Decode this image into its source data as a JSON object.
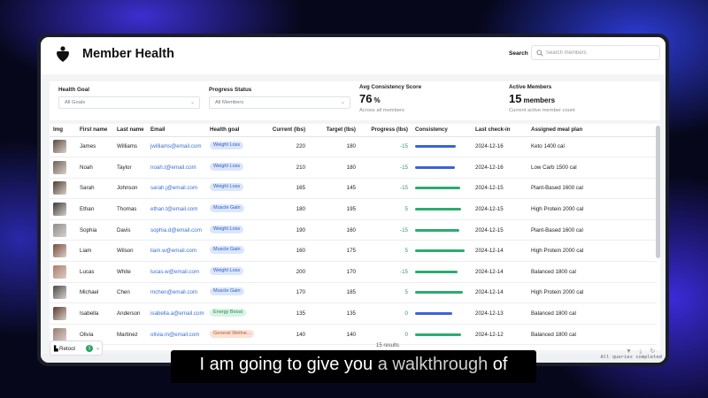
{
  "app": {
    "title": "Member Health",
    "search_label": "Search",
    "search_placeholder": "Search members"
  },
  "filters": {
    "health_goal_label": "Health Goal",
    "health_goal_value": "All Goals",
    "progress_status_label": "Progress Status",
    "progress_status_value": "All Members"
  },
  "stats": {
    "avg_consistency_label": "Avg Consistency Score",
    "avg_consistency_value": "76",
    "avg_consistency_unit": "%",
    "avg_consistency_sub": "Across all members",
    "active_members_label": "Active Members",
    "active_members_value": "15",
    "active_members_unit": "members",
    "active_members_sub": "Current active member count"
  },
  "table": {
    "columns": [
      "Img",
      "First name",
      "Last name",
      "Email",
      "Health goal",
      "Current (lbs)",
      "Target (lbs)",
      "Progress (lbs)",
      "Consistency",
      "Last check-in",
      "Assigned meal plan"
    ],
    "rows": [
      {
        "first": "James",
        "last": "Williams",
        "email": "jwilliams@email.com",
        "goal": "Weight Loss",
        "current": "220",
        "target": "180",
        "progress": "-15",
        "consistency": 0.72,
        "checkin": "2024-12-16",
        "plan": "Keto 1400 cal"
      },
      {
        "first": "Noah",
        "last": "Taylor",
        "email": "noah.t@email.com",
        "goal": "Weight Loss",
        "current": "210",
        "target": "180",
        "progress": "-15",
        "consistency": 0.7,
        "checkin": "2024-12-16",
        "plan": "Low Carb 1500 cal"
      },
      {
        "first": "Sarah",
        "last": "Johnson",
        "email": "sarah.j@email.com",
        "goal": "Weight Loss",
        "current": "165",
        "target": "145",
        "progress": "-15",
        "consistency": 0.8,
        "checkin": "2024-12-15",
        "plan": "Plant-Based 1600 cal"
      },
      {
        "first": "Ethan",
        "last": "Thomas",
        "email": "ethan.t@email.com",
        "goal": "Muscle Gain",
        "current": "180",
        "target": "195",
        "progress": "5",
        "consistency": 0.82,
        "checkin": "2024-12-15",
        "plan": "High Protein 2000 cal"
      },
      {
        "first": "Sophia",
        "last": "Davis",
        "email": "sophia.d@email.com",
        "goal": "Weight Loss",
        "current": "190",
        "target": "160",
        "progress": "-15",
        "consistency": 0.78,
        "checkin": "2024-12-15",
        "plan": "Plant-Based 1600 cal"
      },
      {
        "first": "Liam",
        "last": "Wilson",
        "email": "liam.w@email.com",
        "goal": "Muscle Gain",
        "current": "160",
        "target": "175",
        "progress": "5",
        "consistency": 0.88,
        "checkin": "2024-12-14",
        "plan": "High Protein 2000 cal"
      },
      {
        "first": "Lucas",
        "last": "White",
        "email": "lucas.w@email.com",
        "goal": "Weight Loss",
        "current": "200",
        "target": "170",
        "progress": "-15",
        "consistency": 0.75,
        "checkin": "2024-12-14",
        "plan": "Balanced 1800 cal"
      },
      {
        "first": "Michael",
        "last": "Chen",
        "email": "mchen@email.com",
        "goal": "Muscle Gain",
        "current": "170",
        "target": "185",
        "progress": "5",
        "consistency": 0.85,
        "checkin": "2024-12-14",
        "plan": "High Protein 2000 cal"
      },
      {
        "first": "Isabella",
        "last": "Anderson",
        "email": "isabella.a@email.com",
        "goal": "Energy Boost",
        "current": "135",
        "target": "135",
        "progress": "0",
        "consistency": 0.66,
        "checkin": "2024-12-13",
        "plan": "Balanced 1800 cal"
      },
      {
        "first": "Olivia",
        "last": "Martinez",
        "email": "olivia.m@email.com",
        "goal": "General Wellne...",
        "current": "140",
        "target": "140",
        "progress": "0",
        "consistency": 0.82,
        "checkin": "2024-12-12",
        "plan": "Balanced 1800 cal"
      }
    ],
    "results": "15 results"
  },
  "goal_colors": {
    "Weight Loss": {
      "bg": "#dbe6fb",
      "fg": "#2f5fc4"
    },
    "Muscle Gain": {
      "bg": "#dbe6fb",
      "fg": "#2f5fc4"
    },
    "Energy Boost": {
      "bg": "#d9f3e3",
      "fg": "#1f8a4f"
    },
    "General Wellne...": {
      "bg": "#fbe1d6",
      "fg": "#b85a2c"
    }
  },
  "consistency_colors": {
    "low": "#3b63d8",
    "high": "#2bac6e"
  },
  "status": "All queries completed",
  "retool": {
    "label": "Retool",
    "badge": "1"
  },
  "caption": {
    "before": "I am going to give you ",
    "highlight": "a walkthrough",
    "after": " of"
  }
}
